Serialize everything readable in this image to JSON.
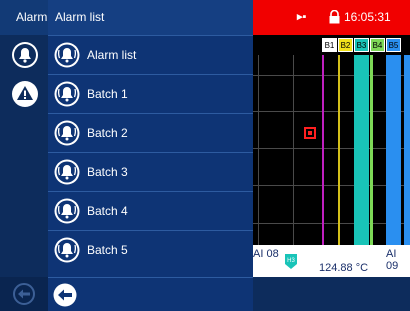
{
  "rail": {
    "title": "Alarm"
  },
  "menu": {
    "header": "Alarm list",
    "items": [
      {
        "label": "Alarm list"
      },
      {
        "label": "Batch 1"
      },
      {
        "label": "Batch 2"
      },
      {
        "label": "Batch 3"
      },
      {
        "label": "Batch 4"
      },
      {
        "label": "Batch 5"
      }
    ]
  },
  "status": {
    "time": "16:05:31"
  },
  "legend": {
    "tags": [
      {
        "label": "B1",
        "color": "#ffffff"
      },
      {
        "label": "B2",
        "color": "#f3e21b"
      },
      {
        "label": "B3",
        "color": "#19c4b8"
      },
      {
        "label": "B4",
        "color": "#7ed957"
      },
      {
        "label": "B5",
        "color": "#2a8ff0"
      }
    ]
  },
  "readout": {
    "channel_left": "AI 08",
    "channel_right": "AI 09",
    "value": "124.88 °C",
    "flag": "H3"
  },
  "colors": {
    "status_bar": "#f10000",
    "panel": "#0e3475",
    "accent": "#2d5ba0"
  }
}
